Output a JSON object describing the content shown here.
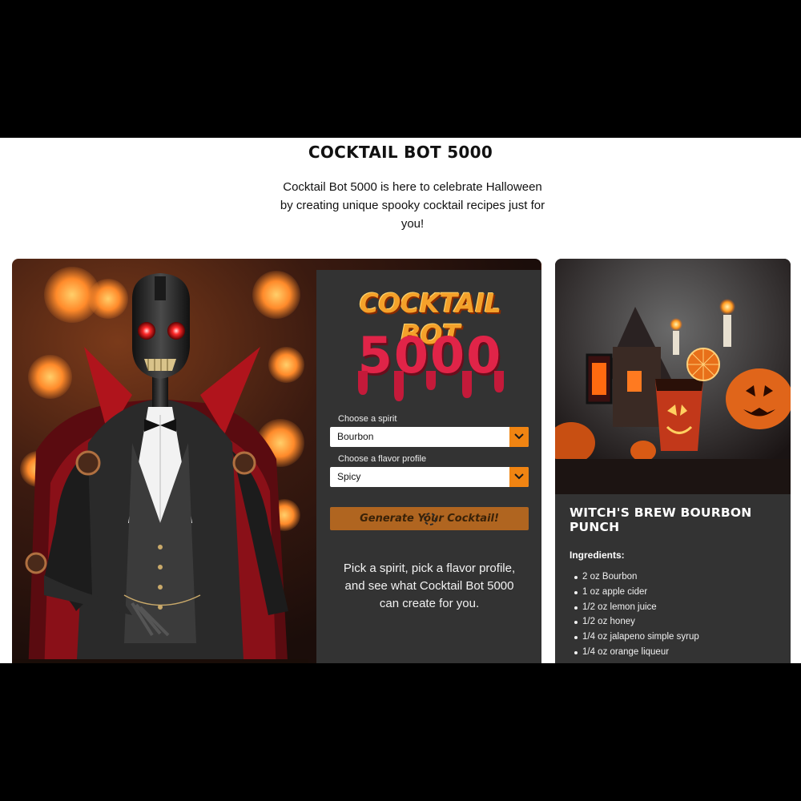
{
  "page": {
    "title": "COCKTAIL BOT 5000",
    "intro": "Cocktail Bot 5000 is here to celebrate Halloween by creating unique spooky cocktail recipes just for you!"
  },
  "logo": {
    "line1": "COCKTAIL BOT",
    "line2": "5000"
  },
  "form": {
    "spirit_label": "Choose a spirit",
    "spirit_value": "Bourbon",
    "flavor_label": "Choose a flavor profile",
    "flavor_value": "Spicy",
    "generate_label": "Generate Your Cocktail!",
    "hint": "Pick a spirit, pick a flavor profile, and see what Cocktail Bot 5000 can create for you."
  },
  "recipe": {
    "title": "WITCH'S BREW BOURBON PUNCH",
    "ingredients_heading": "Ingredients:",
    "ingredients": [
      "2 oz Bourbon",
      "1 oz apple cider",
      "1/2 oz lemon juice",
      "1/2 oz honey",
      "1/4 oz jalapeno simple syrup",
      "1/4 oz orange liqueur"
    ]
  },
  "colors": {
    "accent_orange": "#f08412",
    "button_brown": "#b06520",
    "panel_gray": "#333333",
    "logo_red": "#e02448",
    "logo_orange": "#f4a12a"
  },
  "icons": {
    "select_arrow": "chevron-down-icon",
    "cursor": "busy-cursor-icon"
  }
}
